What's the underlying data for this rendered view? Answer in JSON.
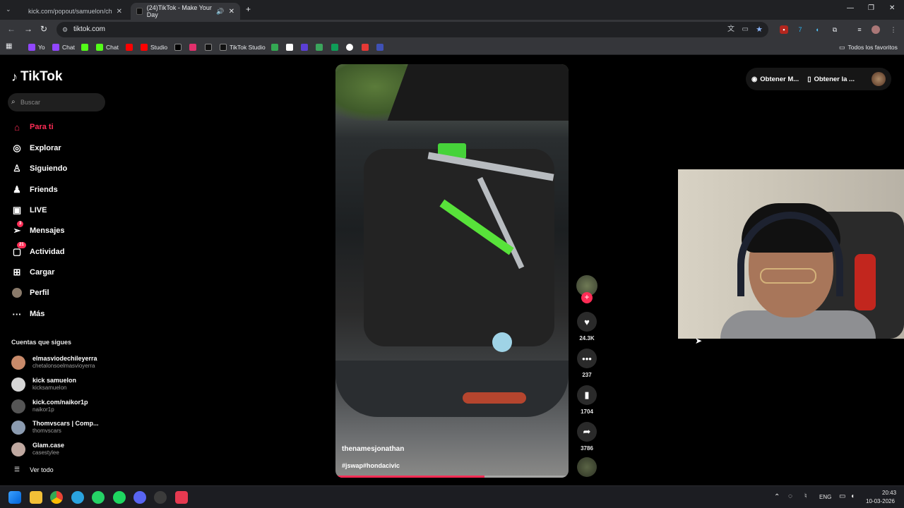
{
  "browser": {
    "tabs": [
      {
        "label": "kick.com/popout/samuelon/ch",
        "favicon_color": "#53fc18"
      },
      {
        "label": "(24)TikTok - Make Your Day",
        "favicon_color": "#111111"
      }
    ],
    "url": "tiktok.com",
    "bookmarks": [
      {
        "label": "Yo",
        "color": "#9146ff"
      },
      {
        "label": "Chat",
        "color": "#9146ff"
      },
      {
        "label": "",
        "color": "#53fc18"
      },
      {
        "label": "Chat",
        "color": "#53fc18"
      },
      {
        "label": "",
        "color": "#ff0000"
      },
      {
        "label": "Studio",
        "color": "#ff0000"
      },
      {
        "label": "",
        "color": "#000000"
      },
      {
        "label": "",
        "color": "#e1306c"
      },
      {
        "label": "",
        "color": "#111111"
      },
      {
        "label": "TikTok Studio",
        "color": "#111111"
      },
      {
        "label": "",
        "color": "#34a853"
      },
      {
        "label": "",
        "color": "#ffffff"
      },
      {
        "label": "",
        "color": "#5b3fd6"
      },
      {
        "label": "",
        "color": "#3ba55c"
      },
      {
        "label": "",
        "color": "#0f9d58"
      },
      {
        "label": "",
        "color": "#ffffff"
      },
      {
        "label": "",
        "color": "#e53935"
      },
      {
        "label": "",
        "color": "#3f51b5"
      }
    ],
    "all_bookmarks": "Todos los favoritos"
  },
  "sidebar": {
    "brand": "TikTok",
    "search_placeholder": "Buscar",
    "nav": [
      {
        "label": "Para ti",
        "icon": "home-icon",
        "badge": ""
      },
      {
        "label": "Explorar",
        "icon": "compass-icon",
        "badge": ""
      },
      {
        "label": "Siguiendo",
        "icon": "following-icon",
        "badge": ""
      },
      {
        "label": "Friends",
        "icon": "friends-icon",
        "badge": ""
      },
      {
        "label": "LIVE",
        "icon": "live-icon",
        "badge": ""
      },
      {
        "label": "Mensajes",
        "icon": "messages-icon",
        "badge": "3"
      },
      {
        "label": "Actividad",
        "icon": "activity-icon",
        "badge": "21"
      },
      {
        "label": "Cargar",
        "icon": "upload-icon",
        "badge": ""
      },
      {
        "label": "Perfil",
        "icon": "profile-icon",
        "badge": ""
      },
      {
        "label": "Más",
        "icon": "more-icon",
        "badge": ""
      }
    ],
    "following_title": "Cuentas que sigues",
    "accounts": [
      {
        "name": "elmasviodechileyerra",
        "handle": "chetalonsoelmasvioyerra",
        "color": "#c88a6a"
      },
      {
        "name": "kick samuelon",
        "handle": "kicksamuelon",
        "color": "#d6d6d6"
      },
      {
        "name": "kick.com/naikor1p",
        "handle": "naikor1p",
        "color": "#555555"
      },
      {
        "name": "Thomvscars | Comp...",
        "handle": "thomvscars",
        "color": "#8b9bb0"
      },
      {
        "name": "Glam.case",
        "handle": "casestylee",
        "color": "#bfa8a0"
      }
    ],
    "see_all": "Ver todo"
  },
  "video": {
    "username": "thenamesjonathan",
    "hashtags": "#jswap#hondacivic",
    "progress": 0.64
  },
  "actions": {
    "likes": "24.3K",
    "comments": "237",
    "saves": "1704",
    "shares": "3786"
  },
  "topright": {
    "get_coins": "Obtener M...",
    "get_app": "Obtener la ..."
  },
  "taskbar": {
    "language": "ENG",
    "time": "20:43",
    "date": "10-03-2026"
  }
}
